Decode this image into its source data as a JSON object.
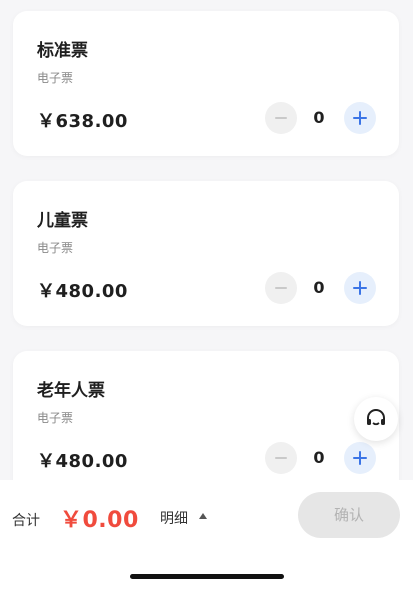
{
  "tickets": [
    {
      "name": "标准票",
      "type": "电子票",
      "price": "￥638.00",
      "quantity": "0"
    },
    {
      "name": "儿童票",
      "type": "电子票",
      "price": "￥480.00",
      "quantity": "0"
    },
    {
      "name": "老年人票",
      "type": "电子票",
      "price": "￥480.00",
      "quantity": "0"
    }
  ],
  "footer": {
    "total_label": "合计",
    "total_amount": "￥0.00",
    "detail_label": "明细",
    "confirm_label": "确认"
  },
  "icons": {
    "service": "headset-icon",
    "decrement": "minus-icon",
    "increment": "plus-icon",
    "detail": "caret-up-icon"
  },
  "colors": {
    "accent_blue": "#3b74e6",
    "price_red": "#f04b3d",
    "disabled_gray": "#e6e6e6"
  }
}
